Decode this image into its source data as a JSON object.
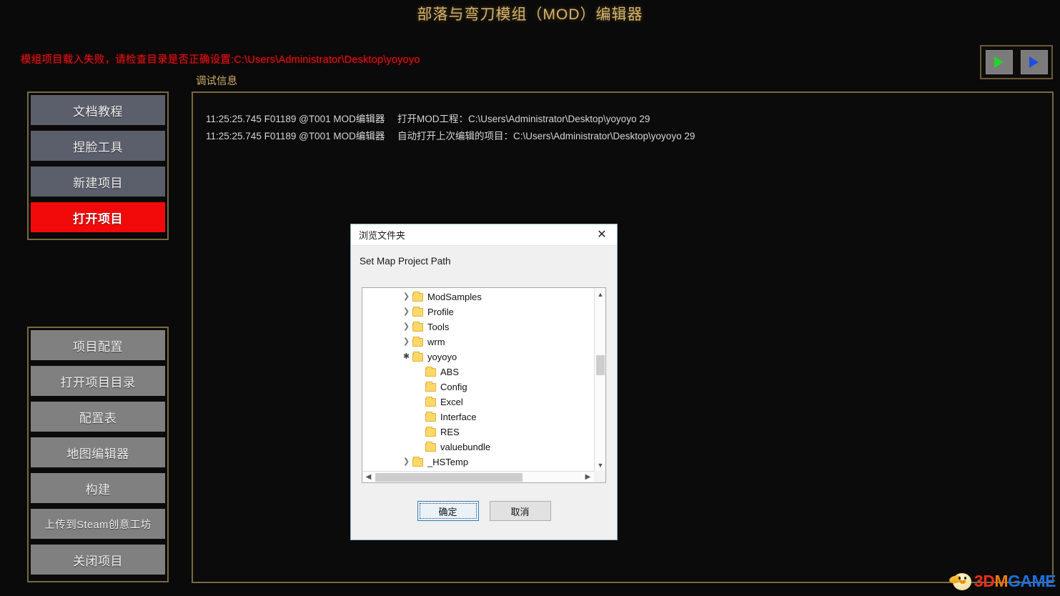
{
  "app": {
    "title": "部落与弯刀模组（MOD）编辑器",
    "title_color": "#d8b46a",
    "error_message": "模组项目载入失败，请检查目录是否正确设置:C:\\Users\\Administrator\\Desktop\\yoyoyo",
    "error_color": "#e01414",
    "debug_label": "调试信息"
  },
  "transport": {
    "run_icon": "play-icon-green",
    "run_icon_color": "#21d62a",
    "debug_icon": "play-icon-blue",
    "debug_icon_color": "#1f4de0"
  },
  "sidebar_top": {
    "items": [
      {
        "label": "文档教程",
        "active": false
      },
      {
        "label": "捏脸工具",
        "active": false
      },
      {
        "label": "新建项目",
        "active": false
      },
      {
        "label": "打开项目",
        "active": true
      }
    ],
    "active_color": "#f20a0a",
    "button_color": "#5a5f6b"
  },
  "sidebar_bottom": {
    "items": [
      {
        "label": "项目配置",
        "small": false
      },
      {
        "label": "打开项目目录",
        "small": false
      },
      {
        "label": "配置表",
        "small": false
      },
      {
        "label": "地图编辑器",
        "small": false
      },
      {
        "label": "构建",
        "small": false
      },
      {
        "label": "上传到Steam创意工坊",
        "small": true
      },
      {
        "label": "关闭项目",
        "small": false
      }
    ],
    "button_color": "#808080"
  },
  "log": {
    "rows": [
      {
        "time": "11:25:25.745 F01189 @T001 MOD编辑器",
        "message": "打开MOD工程：C:\\Users\\Administrator\\Desktop\\yoyoyo 29"
      },
      {
        "time": "11:25:25.745 F01189 @T001 MOD编辑器",
        "message": "自动打开上次编辑的项目：C:\\Users\\Administrator\\Desktop\\yoyoyo 29"
      }
    ]
  },
  "dialog": {
    "title": "浏览文件夹",
    "close_icon": "close-icon",
    "instruction": "Set Map Project Path",
    "tree": [
      {
        "label": "ModSamples",
        "indent": 0,
        "expander": "collapsed"
      },
      {
        "label": "Profile",
        "indent": 0,
        "expander": "collapsed"
      },
      {
        "label": "Tools",
        "indent": 0,
        "expander": "collapsed"
      },
      {
        "label": "wrm",
        "indent": 0,
        "expander": "collapsed"
      },
      {
        "label": "yoyoyo",
        "indent": 0,
        "expander": "expanded"
      },
      {
        "label": "ABS",
        "indent": 1,
        "expander": "none"
      },
      {
        "label": "Config",
        "indent": 1,
        "expander": "none"
      },
      {
        "label": "Excel",
        "indent": 1,
        "expander": "none"
      },
      {
        "label": "Interface",
        "indent": 1,
        "expander": "none"
      },
      {
        "label": "RES",
        "indent": 1,
        "expander": "none"
      },
      {
        "label": "valuebundle",
        "indent": 1,
        "expander": "none"
      },
      {
        "label": "_HSTemp",
        "indent": 0,
        "expander": "collapsed"
      }
    ],
    "scroll_up_icon": "chevron-up-icon",
    "scroll_down_icon": "chevron-down-icon",
    "scroll_left_icon": "chevron-left-icon",
    "scroll_right_icon": "chevron-right-icon",
    "ok_label": "确定",
    "cancel_label": "取消"
  },
  "watermark": {
    "part1": "3D",
    "part2": "M",
    "part3": "GAME"
  }
}
